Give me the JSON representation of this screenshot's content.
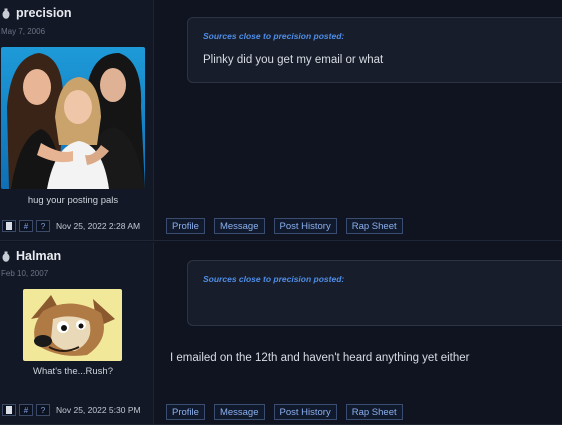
{
  "posts": [
    {
      "username": "precision",
      "join_date": "May 7, 2006",
      "avatar_caption": "hug your posting pals",
      "avatar_icon": "photo-of-three-women",
      "timestamp": "Nov 25, 2022 2:28 AM",
      "quote_header": "Sources close to precision posted:",
      "quote_text": "Plinky did you get my email or what",
      "reply_text": "",
      "footer_icons": [
        "doc-icon",
        "#",
        "?"
      ],
      "actions": [
        "Profile",
        "Message",
        "Post History",
        "Rap Sheet"
      ]
    },
    {
      "username": "Halman",
      "join_date": "Feb 10, 2007",
      "avatar_caption": "What's the...Rush?",
      "avatar_icon": "cartoon-dog",
      "timestamp": "Nov 25, 2022 5:30 PM",
      "quote_header": "Sources close to precision posted:",
      "quote_text": "",
      "reply_text": "I emailed on the 12th and haven't heard anything yet either",
      "footer_icons": [
        "doc-icon",
        "#",
        "?"
      ],
      "actions": [
        "Profile",
        "Message",
        "Post History",
        "Rap Sheet"
      ]
    }
  ],
  "colors": {
    "background": "#0f1420",
    "sidebar": "#121826",
    "quote_header": "#4f8ee8",
    "action_text": "#8bb0ee"
  }
}
